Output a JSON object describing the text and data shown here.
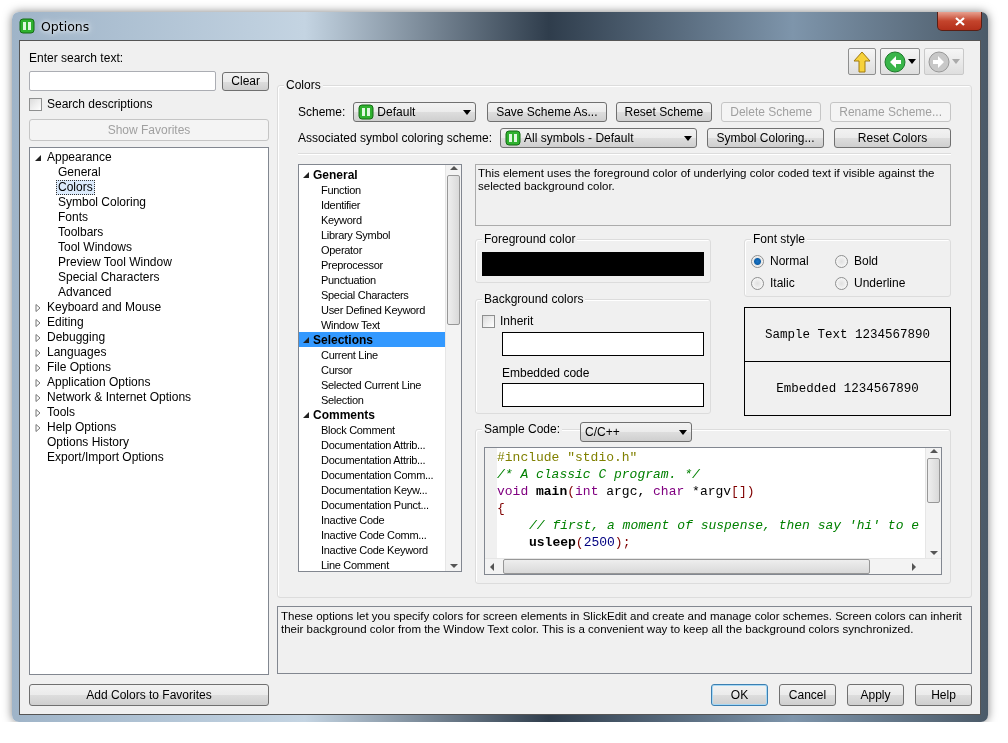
{
  "window": {
    "title": "Options"
  },
  "search": {
    "label": "Enter search text:",
    "clear": "Clear",
    "descriptions": {
      "label": "Search descriptions",
      "checked": false
    },
    "show_favorites": {
      "label": "Show Favorites",
      "disabled": true
    }
  },
  "nav_tree": [
    {
      "label": "Appearance",
      "expanded": true,
      "selected": false,
      "children": [
        {
          "label": "General",
          "selected": false
        },
        {
          "label": "Colors",
          "selected": true
        },
        {
          "label": "Symbol Coloring",
          "selected": false
        },
        {
          "label": "Fonts",
          "selected": false
        },
        {
          "label": "Toolbars",
          "selected": false
        },
        {
          "label": "Tool Windows",
          "selected": false
        },
        {
          "label": "Preview Tool Window",
          "selected": false
        },
        {
          "label": "Special Characters",
          "selected": false
        },
        {
          "label": "Advanced",
          "selected": false
        }
      ]
    },
    {
      "label": "Keyboard and Mouse",
      "expanded": false,
      "selected": false
    },
    {
      "label": "Editing",
      "expanded": false,
      "selected": false
    },
    {
      "label": "Debugging",
      "expanded": false,
      "selected": false
    },
    {
      "label": "Languages",
      "expanded": false,
      "selected": false
    },
    {
      "label": "File Options",
      "expanded": false,
      "selected": false
    },
    {
      "label": "Application Options",
      "expanded": false,
      "selected": false
    },
    {
      "label": "Network & Internet Options",
      "expanded": false,
      "selected": false
    },
    {
      "label": "Tools",
      "expanded": false,
      "selected": false
    },
    {
      "label": "Help Options",
      "expanded": false,
      "selected": false
    },
    {
      "label": "Options History",
      "selected": false
    },
    {
      "label": "Export/Import Options",
      "selected": false
    }
  ],
  "add_favorites": "Add Colors to Favorites",
  "nav_buttons": [
    {
      "kind": "up",
      "disabled": false
    },
    {
      "kind": "back",
      "disabled": false
    },
    {
      "kind": "forward",
      "disabled": true
    }
  ],
  "colors": {
    "title": "Colors",
    "scheme": {
      "label": "Scheme:",
      "value": "Default"
    },
    "scheme_buttons": [
      {
        "label": "Save Scheme As...",
        "disabled": false
      },
      {
        "label": "Reset Scheme",
        "disabled": false
      },
      {
        "label": "Delete Scheme",
        "disabled": true
      },
      {
        "label": "Rename Scheme...",
        "disabled": true
      }
    ],
    "symbol_scheme": {
      "label": "Associated symbol coloring scheme:",
      "value": "All symbols - Default"
    },
    "symbol_buttons": [
      {
        "label": "Symbol Coloring...",
        "disabled": false
      },
      {
        "label": "Reset Colors",
        "disabled": false
      }
    ],
    "elements": [
      {
        "label": "General",
        "expanded": true,
        "selected": false,
        "children": [
          {
            "label": "Function",
            "selected": false
          },
          {
            "label": "Identifier",
            "selected": false
          },
          {
            "label": "Keyword",
            "selected": false
          },
          {
            "label": "Library Symbol",
            "selected": false
          },
          {
            "label": "Operator",
            "selected": false
          },
          {
            "label": "Preprocessor",
            "selected": false
          },
          {
            "label": "Punctuation",
            "selected": false
          },
          {
            "label": "Special Characters",
            "selected": false
          },
          {
            "label": "User Defined Keyword",
            "selected": false
          },
          {
            "label": "Window Text",
            "selected": false
          }
        ]
      },
      {
        "label": "Selections",
        "expanded": true,
        "selected": true,
        "children": [
          {
            "label": "Current Line",
            "selected": false
          },
          {
            "label": "Cursor",
            "selected": false
          },
          {
            "label": "Selected Current Line",
            "selected": false
          },
          {
            "label": "Selection",
            "selected": false
          }
        ]
      },
      {
        "label": "Comments",
        "expanded": true,
        "selected": false,
        "children": [
          {
            "label": "Block Comment",
            "selected": false
          },
          {
            "label": "Documentation Attrib...",
            "selected": false
          },
          {
            "label": "Documentation Attrib...",
            "selected": false
          },
          {
            "label": "Documentation Comm...",
            "selected": false
          },
          {
            "label": "Documentation Keyw...",
            "selected": false
          },
          {
            "label": "Documentation Punct...",
            "selected": false
          },
          {
            "label": "Inactive Code",
            "selected": false
          },
          {
            "label": "Inactive Code Comm...",
            "selected": false
          },
          {
            "label": "Inactive Code Keyword",
            "selected": false
          },
          {
            "label": "Line Comment",
            "selected": false
          }
        ]
      }
    ],
    "element_description": "This element uses the foreground color of underlying color coded text if visible against the selected background color.",
    "foreground": {
      "title": "Foreground color",
      "color": "#000000"
    },
    "background": {
      "title": "Background colors",
      "inherit": {
        "label": "Inherit",
        "checked": false
      },
      "embedded_label": "Embedded code"
    },
    "font_style": {
      "title": "Font style",
      "options": [
        {
          "label": "Normal",
          "selected": true
        },
        {
          "label": "Bold",
          "selected": false
        },
        {
          "label": "Italic",
          "selected": false
        },
        {
          "label": "Underline",
          "selected": false
        }
      ]
    },
    "sample_text": "Sample Text 1234567890",
    "sample_embedded": "Embedded 1234567890",
    "sample_code": {
      "label": "Sample Code:",
      "language": "C/C++",
      "lines": [
        [
          {
            "kind": "preprocessor",
            "text": "#include \"stdio.h\""
          }
        ],
        [
          {
            "kind": "comment",
            "text": "/* A classic C program. */"
          }
        ],
        [
          {
            "kind": "keyword",
            "text": "void "
          },
          {
            "kind": "function",
            "text": "main"
          },
          {
            "kind": "punct",
            "text": "("
          },
          {
            "kind": "keyword",
            "text": "int"
          },
          {
            "kind": "plain",
            "text": " argc, "
          },
          {
            "kind": "keyword",
            "text": "char"
          },
          {
            "kind": "plain",
            "text": " *argv"
          },
          {
            "kind": "punct",
            "text": "[])"
          }
        ],
        [
          {
            "kind": "punct",
            "text": "{"
          }
        ],
        [
          {
            "kind": "comment",
            "text": "// first, a moment of suspense, then say 'hi' to e",
            "indented": true
          }
        ],
        [
          {
            "kind": "function",
            "text": "usleep",
            "indented": true
          },
          {
            "kind": "punct",
            "text": "("
          },
          {
            "kind": "number",
            "text": "2500"
          },
          {
            "kind": "punct",
            "text": ");"
          }
        ]
      ]
    }
  },
  "help_text": "These options let you specify colors for screen elements in SlickEdit and create and manage color schemes. Screen colors can inherit their background color from the Window Text color. This is a convenient way to keep all the background colors synchronized.",
  "dialog_buttons": [
    {
      "label": "OK",
      "default": true
    },
    {
      "label": "Cancel",
      "default": false
    },
    {
      "label": "Apply",
      "default": false
    },
    {
      "label": "Help",
      "default": false
    }
  ]
}
